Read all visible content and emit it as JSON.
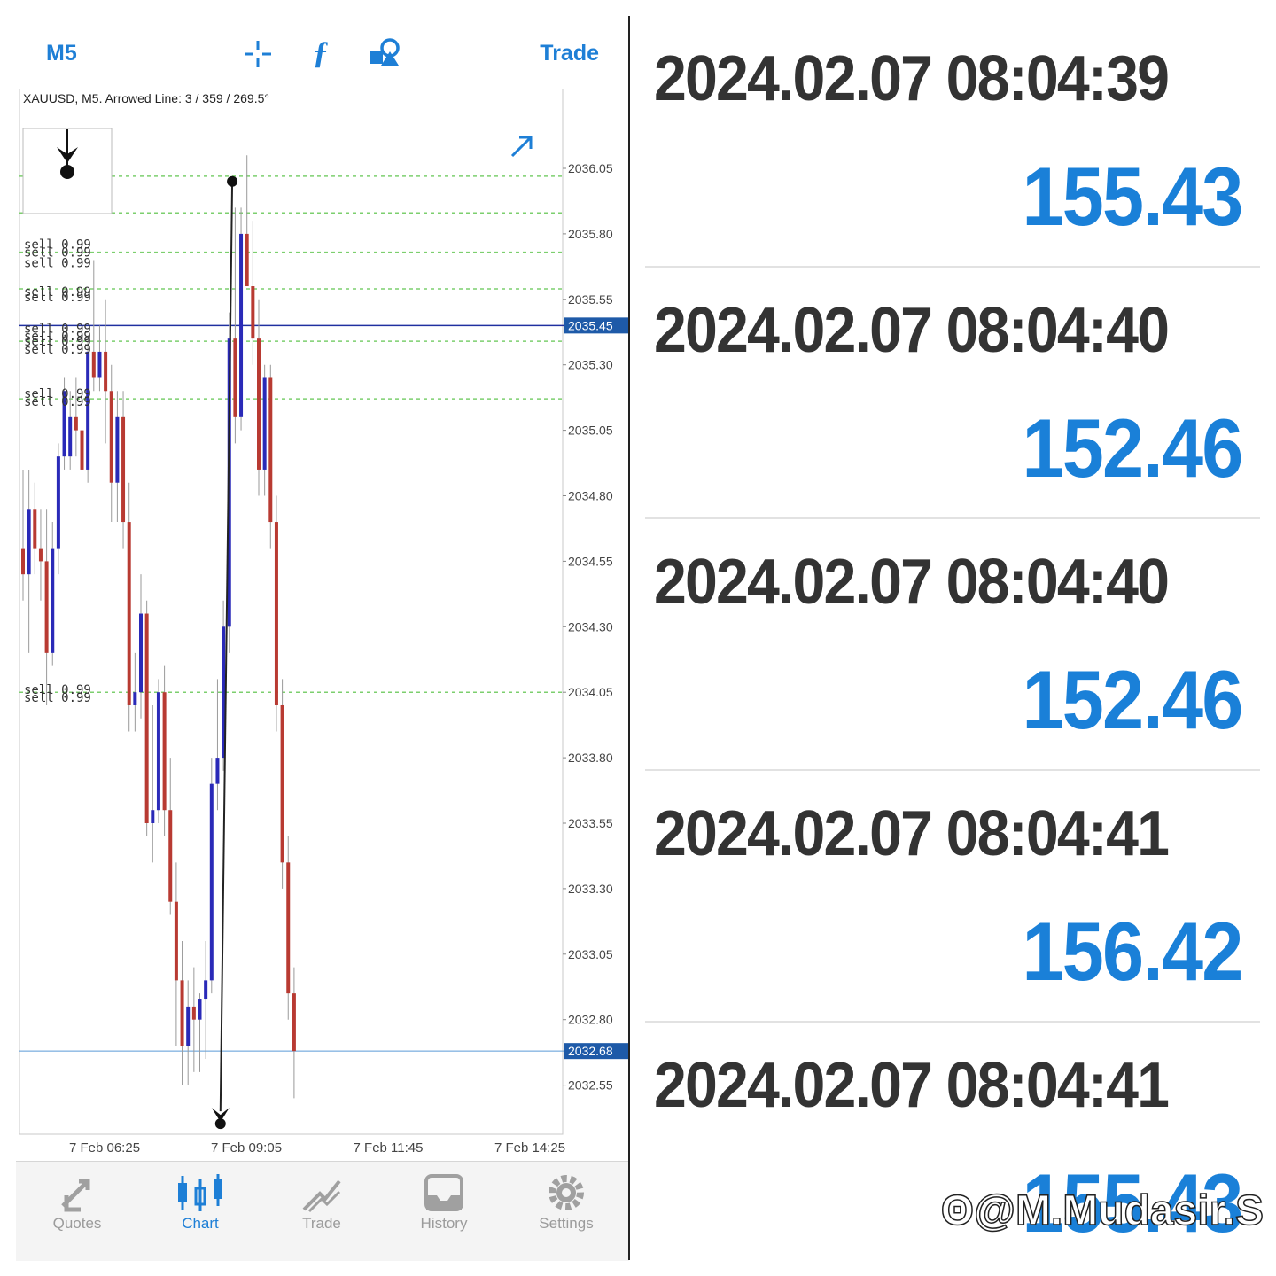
{
  "topbar": {
    "timeframe": "M5",
    "trade_label": "Trade",
    "icons": [
      "crosshair-icon",
      "function-icon",
      "objects-icon"
    ]
  },
  "chart": {
    "info": "XAUUSD, M5. Arrowed Line: 3 / 359 / 269.5°",
    "current_price": "2035.45",
    "low_price": "2032.68",
    "price_ticks": [
      "2036.05",
      "2035.80",
      "2035.55",
      "2035.30",
      "2035.05",
      "2034.80",
      "2034.55",
      "2034.30",
      "2034.05",
      "2033.80",
      "2033.55",
      "2033.30",
      "2033.05",
      "2032.80",
      "2032.55"
    ],
    "time_ticks": [
      "7 Feb 06:25",
      "7 Feb 09:05",
      "7 Feb 11:45",
      "7 Feb 14:25"
    ],
    "order_labels": [
      {
        "text": "sell 0.99",
        "price": 2035.76
      },
      {
        "text": "sell 0.99",
        "price": 2035.73
      },
      {
        "text": "sell 0.99",
        "price": 2035.69
      },
      {
        "text": "sell 0.99",
        "price": 2035.58
      },
      {
        "text": "sell 0.99",
        "price": 2035.56
      },
      {
        "text": "sell 0.99",
        "price": 2035.44
      },
      {
        "text": "sell 0.99",
        "price": 2035.41
      },
      {
        "text": "sell 0.99",
        "price": 2035.39
      },
      {
        "text": "sell 0.99",
        "price": 2035.36
      },
      {
        "text": "sell 0.99",
        "price": 2035.19
      },
      {
        "text": "sell 0.99",
        "price": 2035.16
      },
      {
        "text": "sell 0.99",
        "price": 2034.06
      },
      {
        "text": "sell 0.99",
        "price": 2034.03
      }
    ],
    "order_levels": [
      2036.02,
      2035.88,
      2035.73,
      2035.59,
      2035.39,
      2035.17,
      2034.05
    ],
    "colors": {
      "bull": "#2a2ab8",
      "bear": "#b83a32",
      "grid": "#7ccf6e",
      "accent": "#1e7fd6",
      "price_tag": "#1e5aa8"
    },
    "candles": [
      [
        2034.6,
        2034.9,
        2034.4,
        2034.5
      ],
      [
        2034.5,
        2034.9,
        2034.2,
        2034.75
      ],
      [
        2034.75,
        2034.85,
        2034.5,
        2034.6
      ],
      [
        2034.6,
        2034.75,
        2034.4,
        2034.55
      ],
      [
        2034.55,
        2034.75,
        2034.0,
        2034.2
      ],
      [
        2034.2,
        2034.7,
        2034.15,
        2034.6
      ],
      [
        2034.6,
        2035.0,
        2034.5,
        2034.95
      ],
      [
        2034.95,
        2035.25,
        2034.9,
        2035.2
      ],
      [
        2034.95,
        2035.2,
        2034.9,
        2035.1
      ],
      [
        2035.1,
        2035.25,
        2034.95,
        2035.05
      ],
      [
        2035.05,
        2035.25,
        2034.8,
        2034.9
      ],
      [
        2034.9,
        2035.4,
        2034.85,
        2035.35
      ],
      [
        2035.35,
        2035.7,
        2035.2,
        2035.25
      ],
      [
        2035.25,
        2035.45,
        2035.2,
        2035.35
      ],
      [
        2035.35,
        2035.55,
        2035.0,
        2035.2
      ],
      [
        2035.2,
        2035.3,
        2034.7,
        2034.85
      ],
      [
        2034.85,
        2035.2,
        2034.7,
        2035.1
      ],
      [
        2035.1,
        2035.2,
        2034.6,
        2034.7
      ],
      [
        2034.7,
        2034.85,
        2033.9,
        2034.0
      ],
      [
        2034.0,
        2034.2,
        2033.9,
        2034.05
      ],
      [
        2034.05,
        2034.5,
        2033.95,
        2034.35
      ],
      [
        2034.35,
        2034.4,
        2033.5,
        2033.55
      ],
      [
        2033.55,
        2034.0,
        2033.4,
        2033.6
      ],
      [
        2033.6,
        2034.1,
        2033.55,
        2034.05
      ],
      [
        2034.05,
        2034.15,
        2033.5,
        2033.6
      ],
      [
        2033.6,
        2033.8,
        2033.2,
        2033.25
      ],
      [
        2033.25,
        2033.4,
        2032.7,
        2032.95
      ],
      [
        2032.95,
        2033.1,
        2032.55,
        2032.7
      ],
      [
        2032.7,
        2032.95,
        2032.55,
        2032.85
      ],
      [
        2032.85,
        2033.0,
        2032.6,
        2032.8
      ],
      [
        2032.8,
        2032.9,
        2032.6,
        2032.88
      ],
      [
        2032.88,
        2033.1,
        2032.65,
        2032.95
      ],
      [
        2032.95,
        2033.8,
        2032.9,
        2033.7
      ],
      [
        2033.7,
        2034.1,
        2033.6,
        2033.8
      ],
      [
        2033.8,
        2034.4,
        2033.75,
        2034.3
      ],
      [
        2034.3,
        2035.5,
        2034.2,
        2035.4
      ],
      [
        2035.4,
        2035.9,
        2035.0,
        2035.1
      ],
      [
        2035.1,
        2035.9,
        2035.05,
        2035.8
      ],
      [
        2035.8,
        2036.1,
        2035.6,
        2035.6
      ],
      [
        2035.6,
        2035.85,
        2035.3,
        2035.4
      ],
      [
        2035.4,
        2035.55,
        2034.8,
        2034.9
      ],
      [
        2034.9,
        2035.3,
        2034.8,
        2035.25
      ],
      [
        2035.25,
        2035.3,
        2034.6,
        2034.7
      ],
      [
        2034.7,
        2034.8,
        2033.9,
        2034.0
      ],
      [
        2034.0,
        2034.1,
        2033.3,
        2033.4
      ],
      [
        2033.4,
        2033.5,
        2032.8,
        2032.9
      ],
      [
        2032.9,
        2033.0,
        2032.5,
        2032.68
      ]
    ],
    "arrow_start": {
      "idx": 35.5,
      "price": 2036.0
    },
    "arrow_end": {
      "idx": 33.5,
      "price": 2032.45
    }
  },
  "tabs": [
    {
      "label": "Quotes",
      "icon": "quotes-icon",
      "active": false
    },
    {
      "label": "Chart",
      "icon": "chart-icon",
      "active": true
    },
    {
      "label": "Trade",
      "icon": "trade-icon",
      "active": false
    },
    {
      "label": "History",
      "icon": "history-icon",
      "active": false
    },
    {
      "label": "Settings",
      "icon": "settings-icon",
      "active": false
    }
  ],
  "log_entries": [
    {
      "timestamp": "2024.02.07 08:04:39",
      "value": "155.43"
    },
    {
      "timestamp": "2024.02.07 08:04:40",
      "value": "152.46"
    },
    {
      "timestamp": "2024.02.07 08:04:40",
      "value": "152.46"
    },
    {
      "timestamp": "2024.02.07 08:04:41",
      "value": "156.42"
    },
    {
      "timestamp": "2024.02.07 08:04:41",
      "value": "155.43"
    }
  ],
  "watermark": "@M.Mudasir.S"
}
